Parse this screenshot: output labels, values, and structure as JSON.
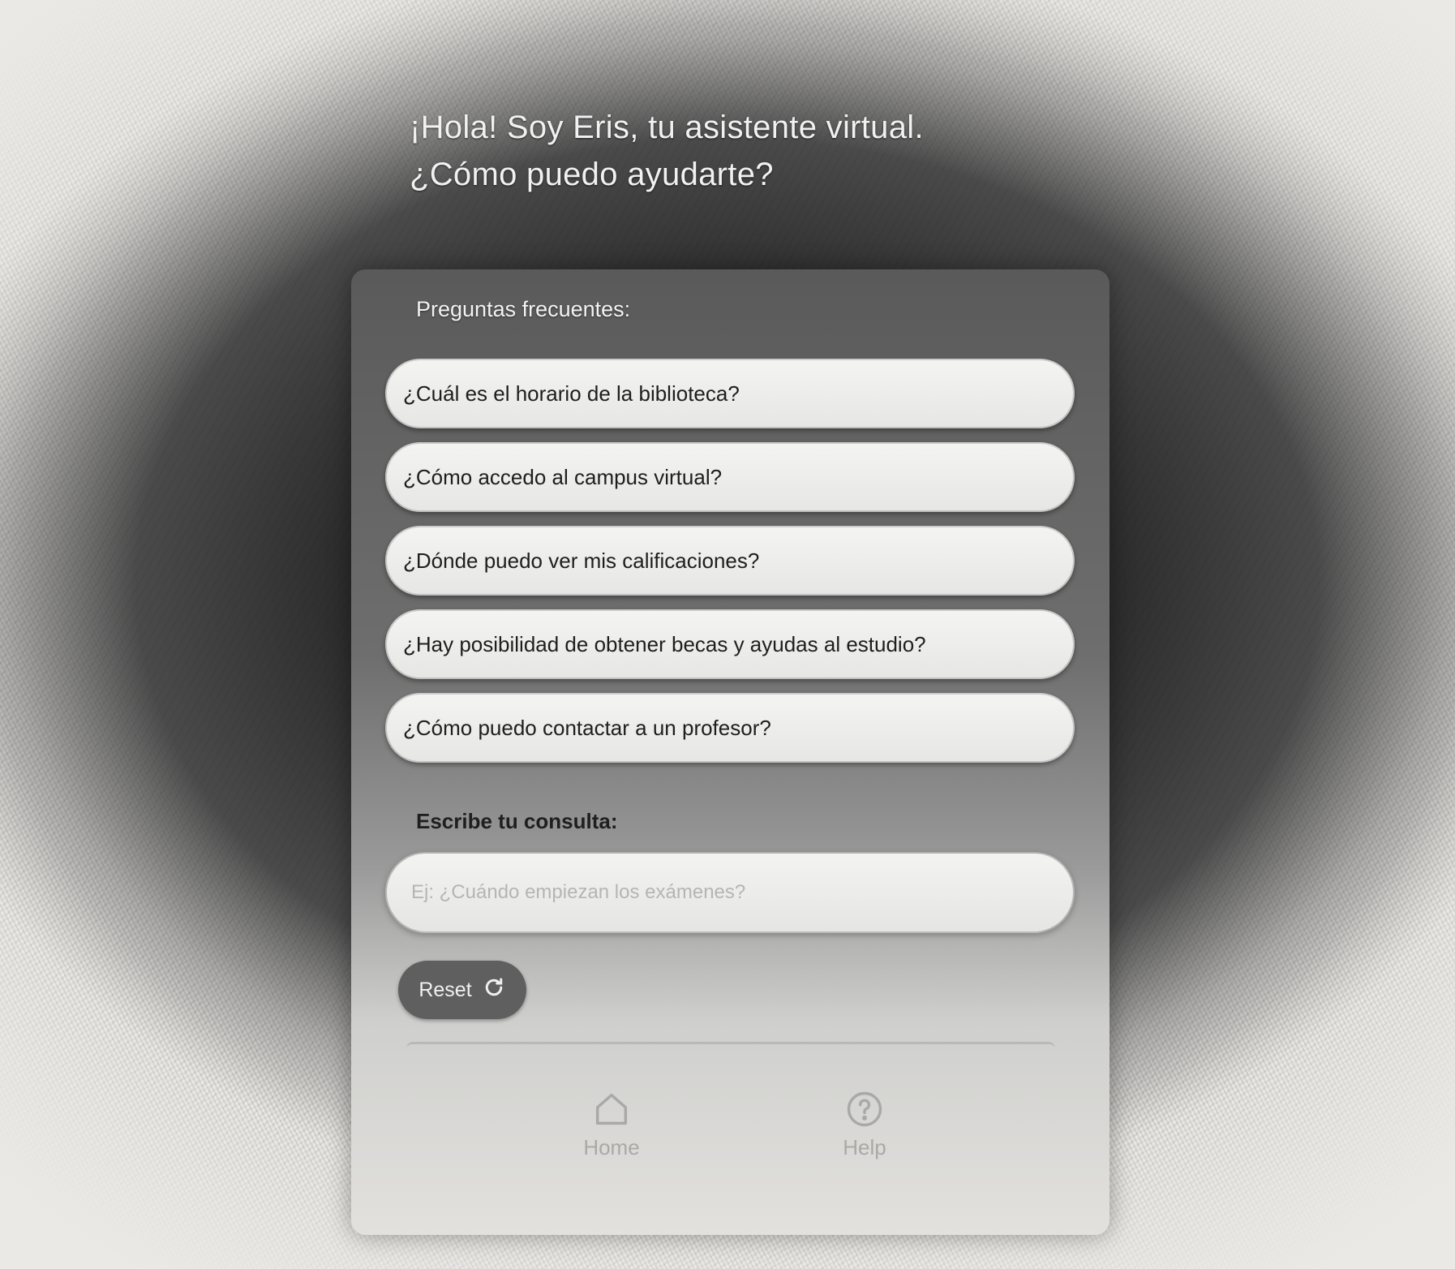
{
  "greeting": {
    "line1": "¡Hola! Soy Eris, tu asistente virtual.",
    "line2": "¿Cómo puedo ayudarte?"
  },
  "faq": {
    "title": "Preguntas frecuentes:",
    "items": [
      "¿Cuál es el horario de la biblioteca?",
      "¿Cómo accedo al campus virtual?",
      "¿Dónde puedo ver mis calificaciones?",
      "¿Hay posibilidad de obtener becas y ayudas al estudio?",
      "¿Cómo puedo contactar a un profesor?"
    ]
  },
  "query": {
    "label": "Escribe tu consulta:",
    "placeholder": "Ej: ¿Cuándo empiezan los exámenes?",
    "value": ""
  },
  "reset": {
    "label": "Reset",
    "icon": "refresh-icon"
  },
  "nav": {
    "home_label": "Home",
    "home_icon": "home-icon",
    "help_label": "Help",
    "help_icon": "help-icon"
  },
  "colors": {
    "panel_top": "#5a5a5a",
    "faq_item_bg": "#f0f0ee",
    "reset_bg": "#5f5f5f",
    "greeting_text": "#f1f1f1"
  }
}
